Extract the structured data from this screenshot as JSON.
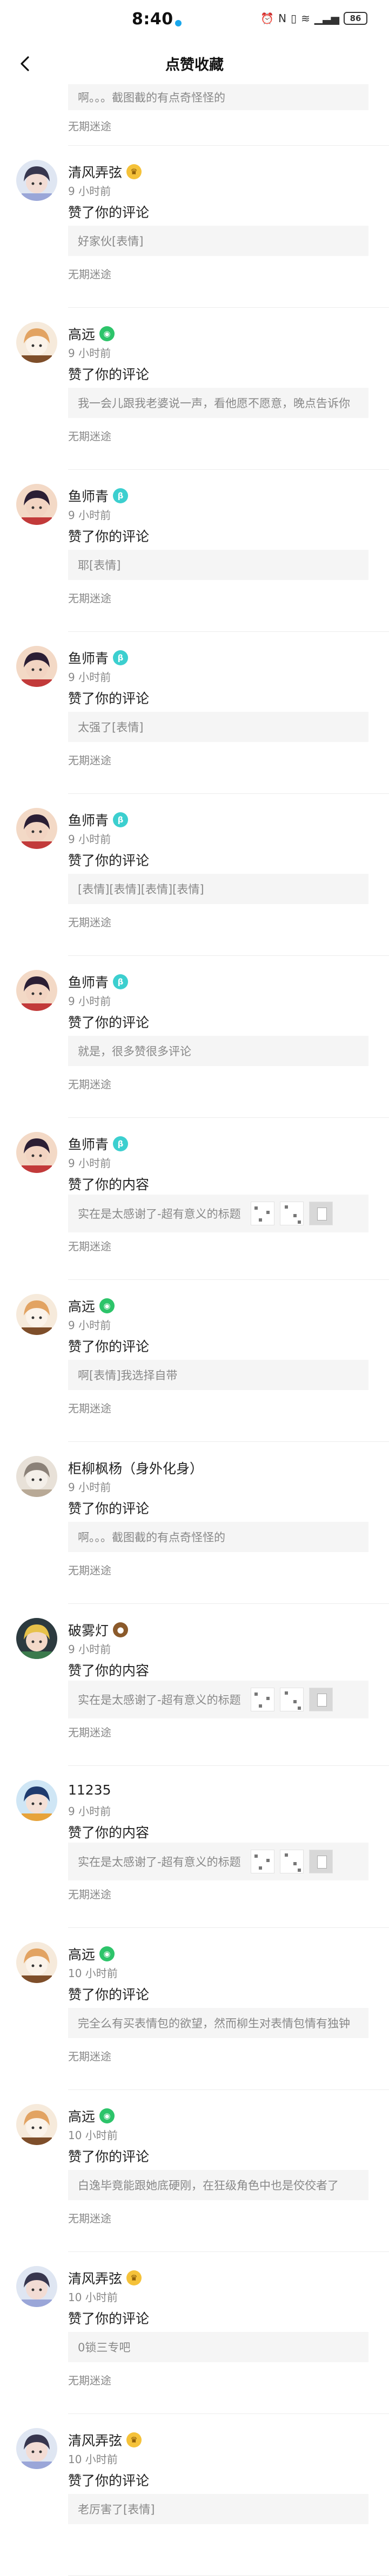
{
  "status_bar": {
    "time": "8:40",
    "battery": "86"
  },
  "nav": {
    "title": "点赞收藏"
  },
  "partial_top": {
    "comment": "啊。。。截图截的有点奇怪怪的",
    "source": "无期迷途"
  },
  "items": [
    {
      "name": "清风弄弦",
      "badge": "cake",
      "time": "9 小时前",
      "action": "赞了你的评论",
      "type": "comment",
      "text": "好家伙[表情]",
      "source": "无期迷途",
      "avatar": {
        "bg": "#dfe6f2",
        "hair": "#37364e",
        "face": "#f2dcd4",
        "accent": "#9aa6d8"
      }
    },
    {
      "name": "高远",
      "badge": "game",
      "time": "9 小时前",
      "action": "赞了你的评论",
      "type": "comment",
      "text": "我一会儿跟我老婆说一声，看他愿不愿意，晚点告诉你",
      "source": "无期迷途",
      "avatar": {
        "bg": "#f6eadb",
        "hair": "#e2a362",
        "face": "#fbf3ea",
        "accent": "#7e4e2a"
      }
    },
    {
      "name": "鱼师青",
      "badge": "fish",
      "time": "9 小时前",
      "action": "赞了你的评论",
      "type": "comment",
      "text": "耶[表情]",
      "source": "无期迷途",
      "avatar": {
        "bg": "#f3d9c6",
        "hair": "#2b1e34",
        "face": "#f2d4c2",
        "accent": "#c23a3a"
      }
    },
    {
      "name": "鱼师青",
      "badge": "fish",
      "time": "9 小时前",
      "action": "赞了你的评论",
      "type": "comment",
      "text": "太强了[表情]",
      "source": "无期迷途",
      "avatar": {
        "bg": "#f3d9c6",
        "hair": "#2b1e34",
        "face": "#f2d4c2",
        "accent": "#c23a3a"
      }
    },
    {
      "name": "鱼师青",
      "badge": "fish",
      "time": "9 小时前",
      "action": "赞了你的评论",
      "type": "comment",
      "text": "[表情][表情][表情][表情]",
      "source": "无期迷途",
      "avatar": {
        "bg": "#f3d9c6",
        "hair": "#2b1e34",
        "face": "#f2d4c2",
        "accent": "#c23a3a"
      }
    },
    {
      "name": "鱼师青",
      "badge": "fish",
      "time": "9 小时前",
      "action": "赞了你的评论",
      "type": "comment",
      "text": "就是，很多赞很多评论",
      "source": "无期迷途",
      "avatar": {
        "bg": "#f3d9c6",
        "hair": "#2b1e34",
        "face": "#f2d4c2",
        "accent": "#c23a3a"
      }
    },
    {
      "name": "鱼师青",
      "badge": "fish",
      "time": "9 小时前",
      "action": "赞了你的内容",
      "type": "content",
      "text": "实在是太感谢了-超有意义的标题",
      "source": "无期迷途",
      "avatar": {
        "bg": "#f3d9c6",
        "hair": "#2b1e34",
        "face": "#f2d4c2",
        "accent": "#c23a3a"
      }
    },
    {
      "name": "高远",
      "badge": "game",
      "time": "9 小时前",
      "action": "赞了你的评论",
      "type": "comment",
      "text": "啊[表情]我选择自带",
      "source": "无期迷途",
      "avatar": {
        "bg": "#f6eadb",
        "hair": "#e2a362",
        "face": "#fbf3ea",
        "accent": "#7e4e2a"
      }
    },
    {
      "name": "柜柳枫杨（身外化身）",
      "badge": "",
      "time": "9 小时前",
      "action": "赞了你的评论",
      "type": "comment",
      "text": "啊。。。截图截的有点奇怪怪的",
      "source": "无期迷途",
      "avatar": {
        "bg": "#e8e1d8",
        "hair": "#8b8178",
        "face": "#f4efe9",
        "accent": "#b8a996"
      }
    },
    {
      "name": "破雾灯",
      "badge": "bear",
      "time": "9 小时前",
      "action": "赞了你的内容",
      "type": "content",
      "text": "实在是太感谢了-超有意义的标题",
      "source": "无期迷途",
      "avatar": {
        "bg": "#2c3a3f",
        "hair": "#e7c24a",
        "face": "#f3d9c8",
        "accent": "#3b7a4c"
      }
    },
    {
      "name": "11235",
      "badge": "",
      "time": "9 小时前",
      "action": "赞了你的内容",
      "type": "content",
      "text": "实在是太感谢了-超有意义的标题",
      "source": "无期迷途",
      "avatar": {
        "bg": "#cfe6f5",
        "hair": "#1f3b6e",
        "face": "#f4e0d6",
        "accent": "#e7a33a"
      }
    },
    {
      "name": "高远",
      "badge": "game",
      "time": "10 小时前",
      "action": "赞了你的评论",
      "type": "comment",
      "text": "完全么有买表情包的欲望，然而柳生对表情包情有独钟",
      "source": "无期迷途",
      "avatar": {
        "bg": "#f6eadb",
        "hair": "#e2a362",
        "face": "#fbf3ea",
        "accent": "#7e4e2a"
      }
    },
    {
      "name": "高远",
      "badge": "game",
      "time": "10 小时前",
      "action": "赞了你的评论",
      "type": "comment",
      "text": "白逸毕竟能跟她底硬刚，在狂级角色中也是佼佼者了",
      "source": "无期迷途",
      "avatar": {
        "bg": "#f6eadb",
        "hair": "#e2a362",
        "face": "#fbf3ea",
        "accent": "#7e4e2a"
      }
    },
    {
      "name": "清风弄弦",
      "badge": "cake",
      "time": "10 小时前",
      "action": "赞了你的评论",
      "type": "comment",
      "text": "0锁三专吧",
      "source": "无期迷途",
      "avatar": {
        "bg": "#dfe6f2",
        "hair": "#37364e",
        "face": "#f2dcd4",
        "accent": "#9aa6d8"
      }
    },
    {
      "name": "清风弄弦",
      "badge": "cake",
      "time": "10 小时前",
      "action": "赞了你的评论",
      "type": "comment",
      "text": "老厉害了[表情]",
      "source": "",
      "avatar": {
        "bg": "#dfe6f2",
        "hair": "#37364e",
        "face": "#f2dcd4",
        "accent": "#9aa6d8"
      }
    }
  ]
}
